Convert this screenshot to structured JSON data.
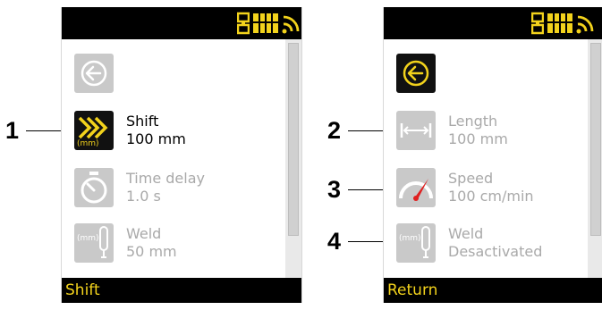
{
  "left_screen": {
    "footer_label": "Shift",
    "items": [
      {
        "icon": "back-arrow-icon"
      },
      {
        "icon": "shift-chevrons-icon",
        "title": "Shift",
        "value": "100 mm",
        "unit_label": "(mm)",
        "selected": true
      },
      {
        "icon": "stopwatch-icon",
        "title": "Time delay",
        "value": "1.0 s"
      },
      {
        "icon": "weld-probe-icon",
        "title": "Weld",
        "value": "50 mm",
        "unit_label": "(mm)"
      }
    ]
  },
  "right_screen": {
    "footer_label": "Return",
    "items": [
      {
        "icon": "back-arrow-icon",
        "selected": true
      },
      {
        "icon": "length-measure-icon",
        "title": "Length",
        "value": "100 mm"
      },
      {
        "icon": "speed-gauge-icon",
        "title": "Speed",
        "value": "100 cm/min"
      },
      {
        "icon": "weld-probe-icon",
        "title": "Weld",
        "value": "Desactivated",
        "unit_label": "(mm)"
      }
    ]
  },
  "callouts": [
    "1",
    "2",
    "3",
    "4"
  ],
  "colors": {
    "accent_yellow": "#f2d21c",
    "tile_grey": "#c9c9c9",
    "inactive_text": "#a9a9a9",
    "bar_black": "#000000",
    "needle_red": "#e02020"
  }
}
